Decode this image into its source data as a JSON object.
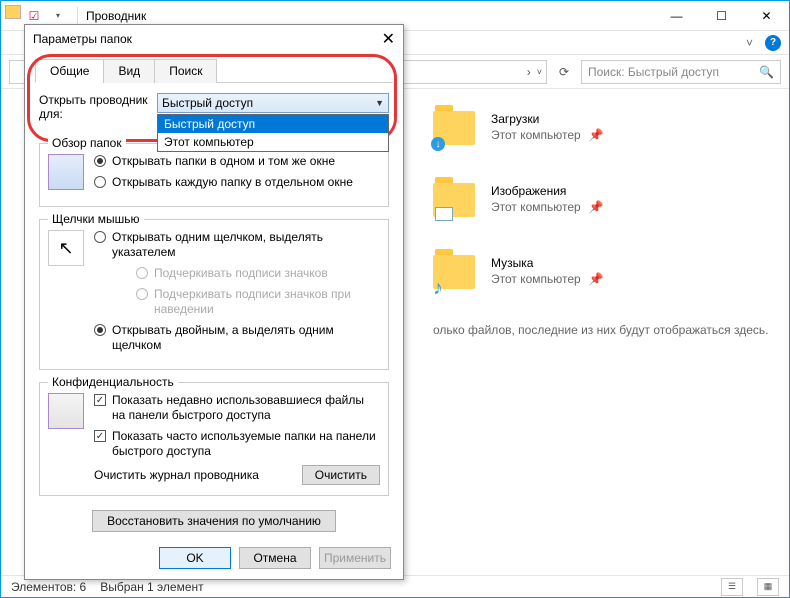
{
  "window": {
    "title": "Проводник",
    "min": "—",
    "max": "☐",
    "close": "✕"
  },
  "navbar": {
    "address_sep": "›",
    "refresh": "⟳",
    "search_placeholder": "Поиск: Быстрый доступ",
    "search_icon": "🔍",
    "chevron": "˅",
    "help": "?"
  },
  "folders": [
    {
      "name": "Загрузки",
      "sub": "Этот компьютер",
      "overlay": "↓",
      "overlay_bg": "#2e9de0"
    },
    {
      "name": "Изображения",
      "sub": "Этот компьютер",
      "overlay": "",
      "overlay_bg": ""
    },
    {
      "name": "Музыка",
      "sub": "Этот компьютер",
      "overlay": "♪",
      "overlay_bg": "#2e9de0"
    }
  ],
  "empty": "олько файлов, последние из них будут отображаться здесь.",
  "status": {
    "count": "Элементов: 6",
    "selected": "Выбран 1 элемент"
  },
  "dialog": {
    "title": "Параметры папок",
    "close": "✕",
    "tabs": [
      "Общие",
      "Вид",
      "Поиск"
    ],
    "open_label": "Открыть проводник для:",
    "combo_value": "Быстрый доступ",
    "combo_options": [
      "Быстрый доступ",
      "Этот компьютер"
    ],
    "browse": {
      "legend": "Обзор папок",
      "same": "Открывать папки в одном и том же окне",
      "new": "Открывать каждую папку в отдельном окне"
    },
    "clicks": {
      "legend": "Щелчки мышью",
      "single": "Открывать одним щелчком, выделять указателем",
      "underline_icon": "Подчеркивать подписи значков",
      "underline_hover": "Подчеркивать подписи значков при наведении",
      "double": "Открывать двойным, а выделять одним щелчком"
    },
    "privacy": {
      "legend": "Конфиденциальность",
      "recent_files": "Показать недавно использовавшиеся файлы на панели быстрого доступа",
      "freq_folders": "Показать часто используемые папки на панели быстрого доступа",
      "clear_label": "Очистить журнал проводника",
      "clear_btn": "Очистить"
    },
    "restore": "Восстановить значения по умолчанию",
    "ok": "OK",
    "cancel": "Отмена",
    "apply": "Применить"
  }
}
